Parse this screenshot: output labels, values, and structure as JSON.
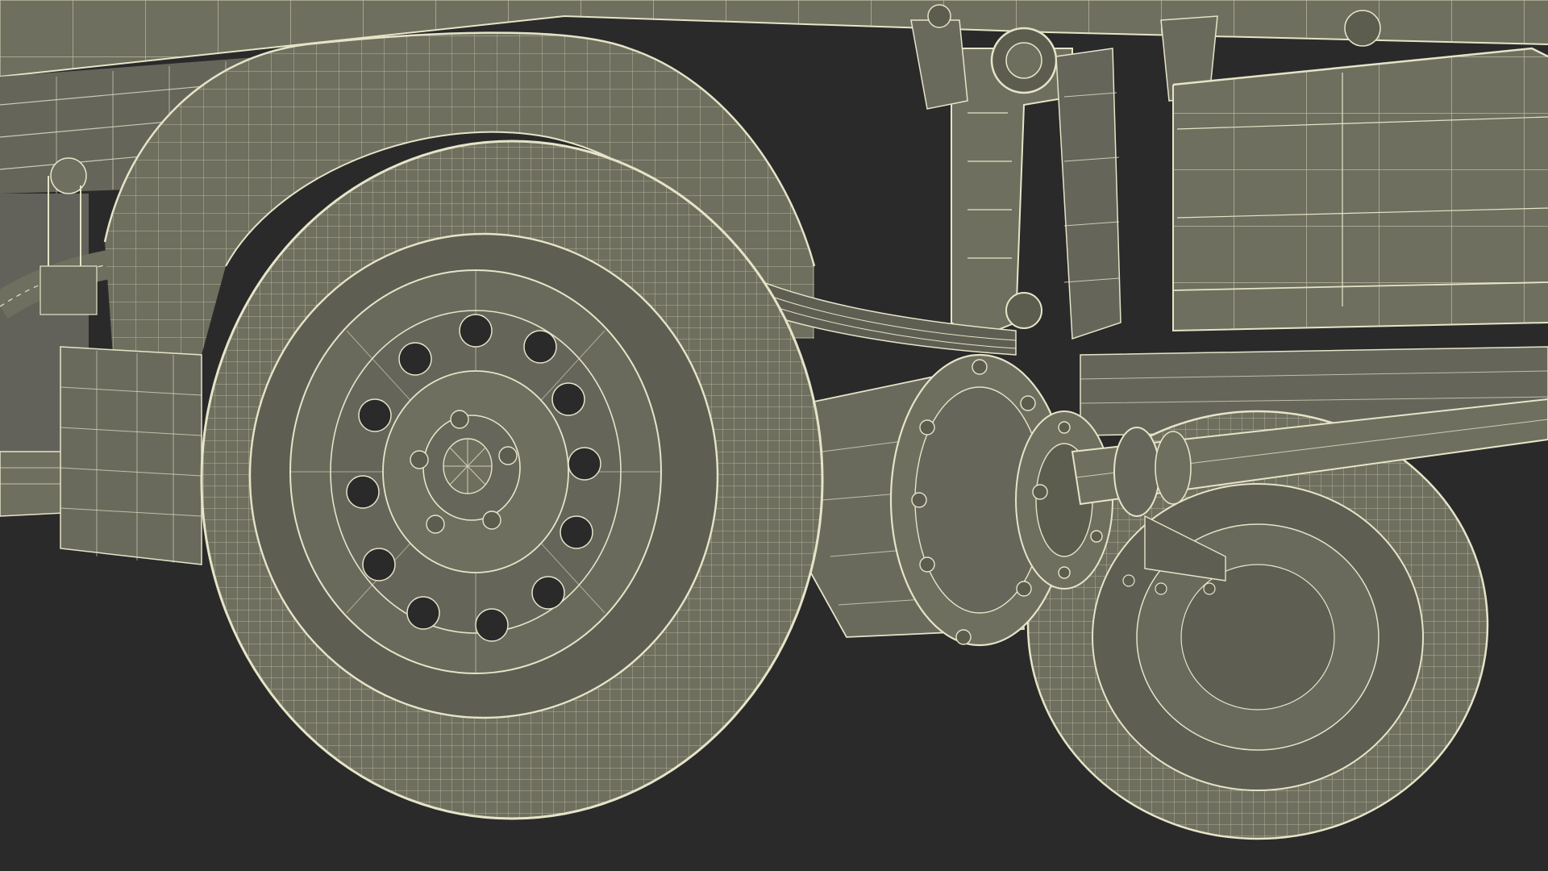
{
  "scene": {
    "subject": "truck-rear-axle-wireframe-render",
    "colors": {
      "background": "#2a2a2a",
      "surface": "#6f6f5f",
      "surface_dark": "#5c5c4f",
      "surface_light": "#7d7d6b",
      "wire": "#e6e4c8",
      "wire_dim": "#cfcdb2",
      "shadow": "#3a3a32"
    },
    "icons": {
      "render": "wireframe-truck-axle"
    }
  }
}
